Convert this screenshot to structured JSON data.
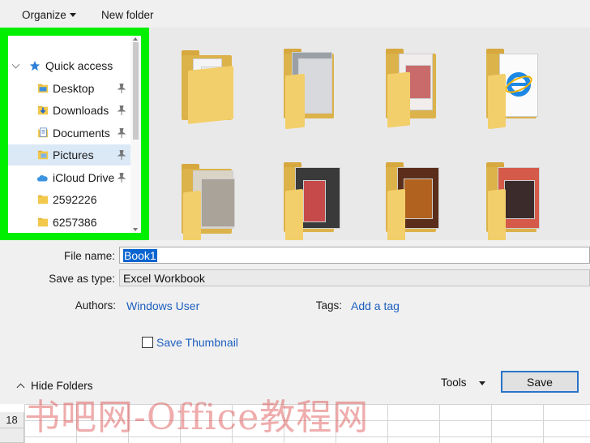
{
  "toolbar": {
    "organize_label": "Organize",
    "new_folder_label": "New folder"
  },
  "nav": {
    "items": [
      {
        "label": "Quick access",
        "icon": "star-icon"
      },
      {
        "label": "Desktop",
        "icon": "desktop-folder-icon"
      },
      {
        "label": "Downloads",
        "icon": "downloads-folder-icon"
      },
      {
        "label": "Documents",
        "icon": "documents-folder-icon"
      },
      {
        "label": "Pictures",
        "icon": "pictures-folder-icon"
      },
      {
        "label": "iCloud Drive",
        "icon": "cloud-icon"
      },
      {
        "label": "2592226",
        "icon": "folder-icon"
      },
      {
        "label": "6257386",
        "icon": "folder-icon"
      }
    ],
    "highlight_color": "#00ee00"
  },
  "form": {
    "file_name_label": "File name:",
    "file_name_value": "Book1",
    "save_as_type_label": "Save as type:",
    "save_as_type_value": "Excel Workbook",
    "authors_label": "Authors:",
    "authors_value": "Windows User",
    "tags_label": "Tags:",
    "tags_value": "Add a tag",
    "save_thumbnail_label": "Save Thumbnail",
    "hide_folders_label": "Hide Folders",
    "tools_label": "Tools",
    "save_label": "Save"
  },
  "sheet": {
    "row_label": "18"
  },
  "watermark": "书吧网-Office教程网"
}
